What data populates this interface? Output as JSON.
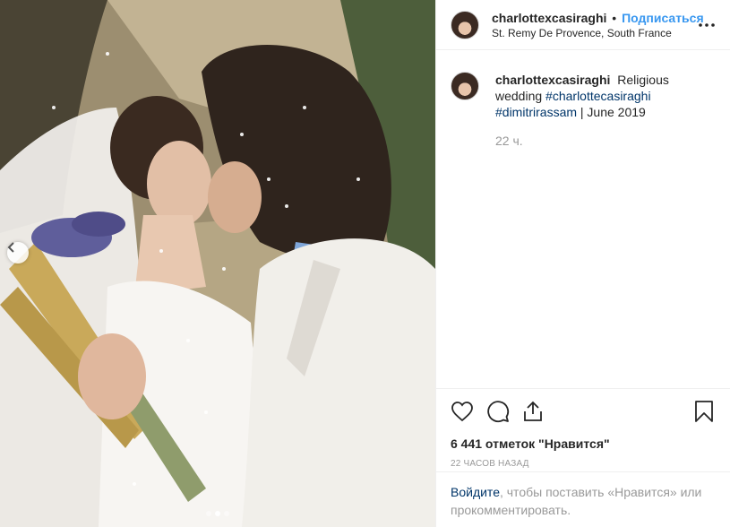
{
  "post": {
    "username": "charlottexcasiraghi",
    "bullet": "•",
    "follow_label": "Подписаться",
    "location": "St. Remy De Provence, South France",
    "more_icon": "more-horizontal-icon"
  },
  "caption": {
    "username": "charlottexcasiraghi",
    "text_before": "Religious wedding",
    "hashtag_1": "#charlottecasiraghi",
    "hashtag_2": "#dimitrirassam",
    "text_after": "| June 2019",
    "time": "22 ч."
  },
  "actions": {
    "like_icon": "heart-icon",
    "comment_icon": "comment-icon",
    "share_icon": "share-icon",
    "save_icon": "bookmark-icon"
  },
  "stats": {
    "likes": "6 441 отметок \"Нравится\"",
    "time_ago": "22 часов назад"
  },
  "login_prompt": {
    "link": "Войдите",
    "rest": ", чтобы поставить «Нравится» или прокомментировать."
  },
  "carousel": {
    "slide_count": 3,
    "active_slide": 2
  },
  "colors": {
    "link_blue": "#3897f0",
    "hashtag_blue": "#003569",
    "muted": "#999999"
  }
}
